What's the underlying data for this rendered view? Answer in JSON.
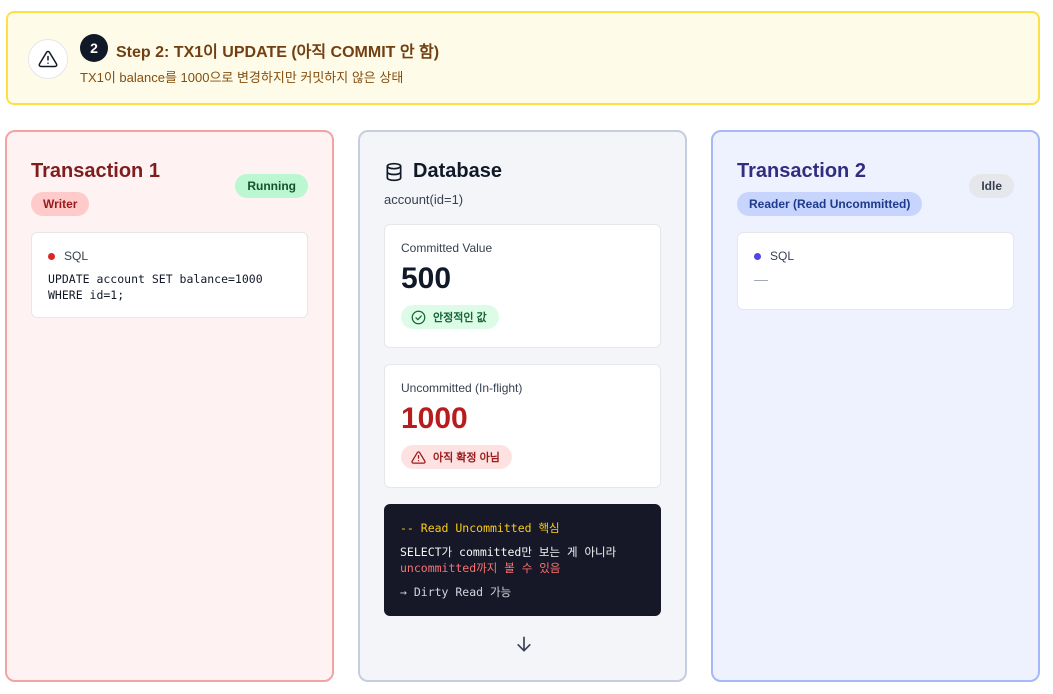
{
  "step": {
    "number": "2",
    "title": "Step 2: TX1이 UPDATE (아직 COMMIT 안 함)",
    "subtitle": "TX1이 balance를 1000으로 변경하지만 커밋하지 않은 상태",
    "icon": "warning-triangle-icon"
  },
  "tx1": {
    "title": "Transaction 1",
    "role": "Writer",
    "status": "Running",
    "sql_label": "SQL",
    "sql_code": "UPDATE account SET balance=1000\nWHERE id=1;"
  },
  "database": {
    "title": "Database",
    "subtitle": "account(id=1)",
    "icon": "database-icon",
    "committed": {
      "label": "Committed Value",
      "value": "500",
      "badge": "안정적인 값",
      "badge_icon": "check-circle-icon"
    },
    "uncommitted": {
      "label": "Uncommitted (In-flight)",
      "value": "1000",
      "badge": "아직 확정 아님",
      "badge_icon": "warning-triangle-icon"
    },
    "note": {
      "comment": "-- Read Uncommitted 핵심",
      "line1": "SELECT가 committed만 보는 게 아니라",
      "line2": "uncommitted까지 볼 수 있음",
      "line3": "→ Dirty Read 가능"
    },
    "arrow_icon": "arrow-down-icon"
  },
  "tx2": {
    "title": "Transaction 2",
    "role": "Reader (Read Uncommitted)",
    "status": "Idle",
    "sql_label": "SQL",
    "sql_code": "—"
  },
  "colors": {
    "tx1_accent": "#7f1d1d",
    "tx2_accent": "#312e81",
    "uncommitted_value": "#b91c1c",
    "banner_bg": "#fefce8",
    "banner_border": "#fde047"
  }
}
